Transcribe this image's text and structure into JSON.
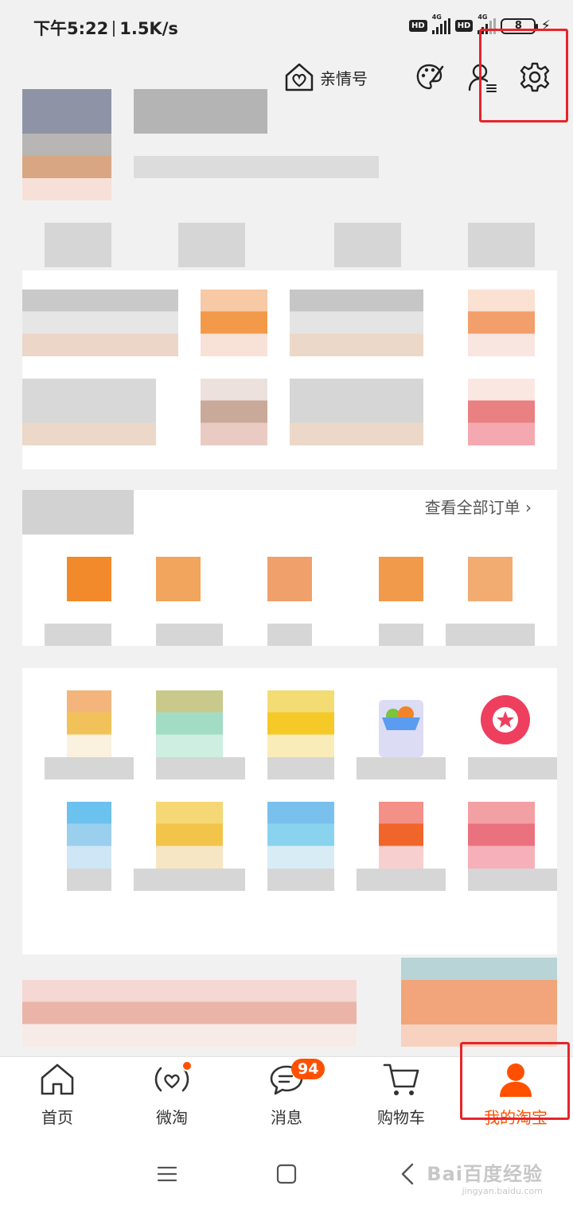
{
  "status_bar": {
    "time": "下午5:22",
    "speed": "1.5K/s",
    "hd_label": "HD",
    "net_label": "4G",
    "battery": "8"
  },
  "top_actions": {
    "family_label": "亲情号"
  },
  "orders": {
    "view_all": "查看全部订单 ›"
  },
  "tabbar": {
    "tabs": [
      {
        "label": "首页",
        "icon": "home-icon"
      },
      {
        "label": "微淘",
        "icon": "weitao-icon"
      },
      {
        "label": "消息",
        "icon": "message-icon",
        "badge": "94"
      },
      {
        "label": "购物车",
        "icon": "cart-icon"
      },
      {
        "label": "我的淘宝",
        "icon": "user-icon"
      }
    ],
    "active": 4
  },
  "watermark": {
    "main": "Bai百度经验",
    "sub": "jingyan.baidu.com"
  },
  "colors": {
    "accent": "#ff5000",
    "highlight": "#e8242b",
    "background": "#f1f1f1"
  }
}
